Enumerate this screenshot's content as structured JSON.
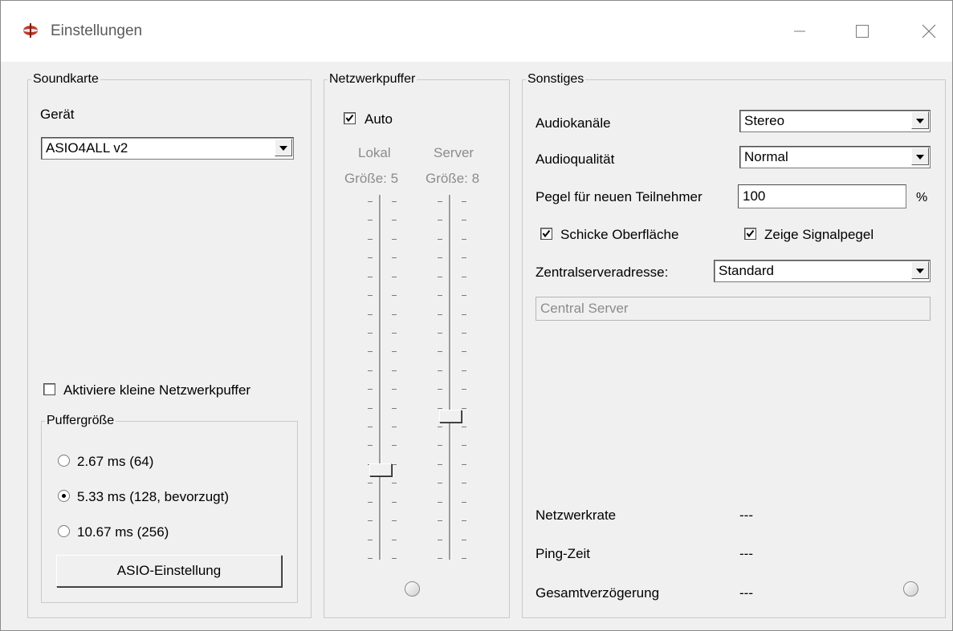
{
  "window": {
    "title": "Einstellungen",
    "icon": "jamulus-app-icon",
    "controls": [
      "minimize-icon",
      "maximize-icon",
      "close-icon"
    ]
  },
  "soundkarte": {
    "legend": "Soundkarte",
    "device_label": "Gerät",
    "device_value": "ASIO4ALL v2",
    "small_buffers_label": "Aktiviere kleine Netzwerkpuffer",
    "small_buffers_checked": false,
    "buffer_group": {
      "legend": "Puffergröße",
      "options": [
        {
          "label": "2.67 ms (64)",
          "checked": false
        },
        {
          "label": "5.33 ms (128, bevorzugt)",
          "checked": true
        },
        {
          "label": "10.67 ms (256)",
          "checked": false
        }
      ]
    },
    "asio_button": "ASIO-Einstellung"
  },
  "netzwerkpuffer": {
    "legend": "Netzwerkpuffer",
    "auto_label": "Auto",
    "auto_checked": true,
    "local": {
      "label": "Lokal",
      "size": "Größe: 5",
      "value": 5
    },
    "server": {
      "label": "Server",
      "size": "Größe: 8",
      "value": 8
    }
  },
  "sonstiges": {
    "legend": "Sonstiges",
    "channels_label": "Audiokanäle",
    "channels_value": "Stereo",
    "quality_label": "Audioqualität",
    "quality_value": "Normal",
    "level_label": "Pegel für neuen Teilnehmer",
    "level_value": "100",
    "level_unit": "%",
    "fancy_skin_label": "Schicke Oberfläche",
    "fancy_skin_checked": true,
    "show_levels_label": "Zeige Signalpegel",
    "show_levels_checked": true,
    "central_server_label": "Zentralserveradresse:",
    "central_server_value": "Standard",
    "central_server_field": "Central Server",
    "stats": [
      {
        "label": "Netzwerkrate",
        "value": "---"
      },
      {
        "label": "Ping-Zeit",
        "value": "---"
      },
      {
        "label": "Gesamtverzögerung",
        "value": "---"
      }
    ]
  }
}
